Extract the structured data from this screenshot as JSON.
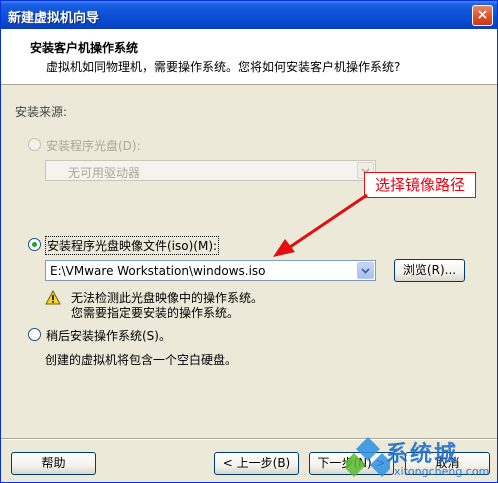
{
  "window": {
    "title": "新建虚拟机向导",
    "close": "×"
  },
  "header": {
    "title": "安装客户机操作系统",
    "description": "虚拟机如同物理机，需要操作系统。您将如何安装客户机操作系统?"
  },
  "install_source": {
    "section_label": "安装来源:",
    "disc_option": {
      "label": "安装程序光盘(D):",
      "selected": false,
      "disabled": true
    },
    "drive_select": {
      "value": "无可用驱动器",
      "disabled": true
    },
    "iso_option": {
      "label": "安装程序光盘映像文件(iso)(M):",
      "selected": true
    },
    "iso_path": {
      "value": "E:\\VMware Workstation\\windows.iso"
    },
    "browse_label": "浏览(R)...",
    "warning_line1": "无法检测此光盘映像中的操作系统。",
    "warning_line2": "您需要指定要安装的操作系统。",
    "later_option": {
      "label": "稍后安装操作系统(S)。",
      "selected": false
    },
    "later_desc": "创建的虚拟机将包含一个空白硬盘。"
  },
  "annotation": {
    "text": "选择镜像路径",
    "color": "#e01010"
  },
  "footer": {
    "help_label": "帮助",
    "back_label": "< 上一步(B)",
    "next_label": "下一步(N) >",
    "cancel_label": "取消"
  },
  "watermark": {
    "text": "系统城",
    "url": "xitongcheng.com"
  },
  "colors": {
    "title_bar": "#0a4fd6",
    "dialog_bg": "#ece9d8",
    "accent_radio": "#21a121"
  }
}
